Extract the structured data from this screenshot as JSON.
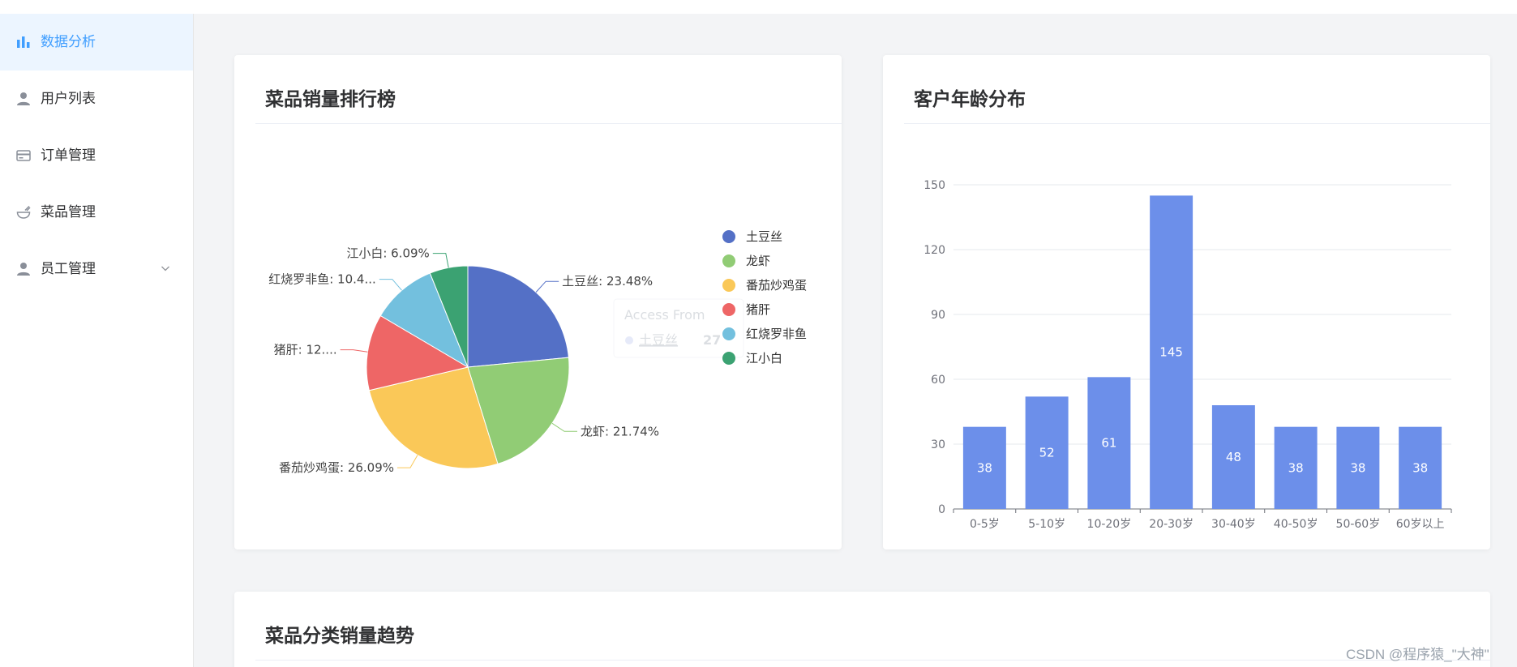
{
  "sidebar": {
    "items": [
      {
        "label": "数据分析",
        "icon": "bar-chart-icon",
        "active": true
      },
      {
        "label": "用户列表",
        "icon": "user-icon",
        "active": false
      },
      {
        "label": "订单管理",
        "icon": "credit-card-icon",
        "active": false
      },
      {
        "label": "菜品管理",
        "icon": "dish-bowl-icon",
        "active": false
      },
      {
        "label": "员工管理",
        "icon": "user-icon",
        "active": false,
        "has_submenu": true
      }
    ]
  },
  "colors": {
    "accent": "#409eff",
    "bar": "#6c8fea",
    "pie": [
      "#5470c6",
      "#91cc75",
      "#fac858",
      "#ee6666",
      "#73c0de",
      "#3ba272"
    ]
  },
  "cards": {
    "dish_ranking": {
      "title": "菜品销量排行榜"
    },
    "age_distribution": {
      "title": "客户年龄分布"
    },
    "category_trend": {
      "title": "菜品分类销量趋势"
    }
  },
  "tooltip": {
    "title": "Access From",
    "item_label": "土豆丝",
    "item_value": "27"
  },
  "watermark": "CSDN @程序猿_\"大神\"",
  "chart_data": [
    {
      "type": "pie",
      "slices": [
        {
          "name": "土豆丝",
          "percent": 23.48,
          "label": "土豆丝: 23.48%"
        },
        {
          "name": "龙虾",
          "percent": 21.74,
          "label": "龙虾: 21.74%"
        },
        {
          "name": "番茄炒鸡蛋",
          "percent": 26.09,
          "label": "番茄炒鸡蛋: 26.09%"
        },
        {
          "name": "猪肝",
          "percent": 12.17,
          "label": "猪肝: 12...."
        },
        {
          "name": "红烧罗非鱼",
          "percent": 10.43,
          "label": "红烧罗非鱼: 10.4..."
        },
        {
          "name": "江小白",
          "percent": 6.09,
          "label": "江小白: 6.09%"
        }
      ],
      "legend": [
        "土豆丝",
        "龙虾",
        "番茄炒鸡蛋",
        "猪肝",
        "红烧罗非鱼",
        "江小白"
      ],
      "legend_position": "right"
    },
    {
      "type": "bar",
      "categories": [
        "0-5岁",
        "5-10岁",
        "10-20岁",
        "20-30岁",
        "30-40岁",
        "40-50岁",
        "50-60岁",
        "60岁以上"
      ],
      "values": [
        38,
        52,
        61,
        145,
        48,
        38,
        38,
        38
      ],
      "ylim": [
        0,
        150
      ],
      "yticks": [
        "0",
        "30",
        "60",
        "90",
        "120",
        "150"
      ],
      "grid": true,
      "data_labels": [
        "38",
        "52",
        "61",
        "145",
        "48",
        "38",
        "38",
        "38"
      ]
    }
  ]
}
